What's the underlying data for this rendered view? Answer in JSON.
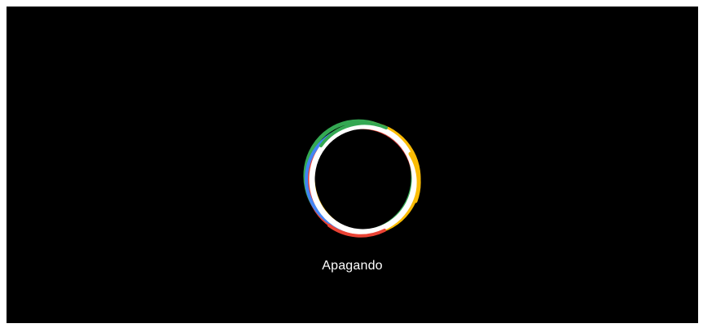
{
  "screen": {
    "status_text": "Apagando",
    "spinner_icon": "multicolor-ring-spinner-icon"
  },
  "colors": {
    "background": "#000000",
    "text": "#ffffff",
    "ring_green": "#34a853",
    "ring_red": "#ea4335",
    "ring_yellow": "#fbbc05",
    "ring_blue": "#4285f4",
    "ring_white": "#ffffff"
  }
}
